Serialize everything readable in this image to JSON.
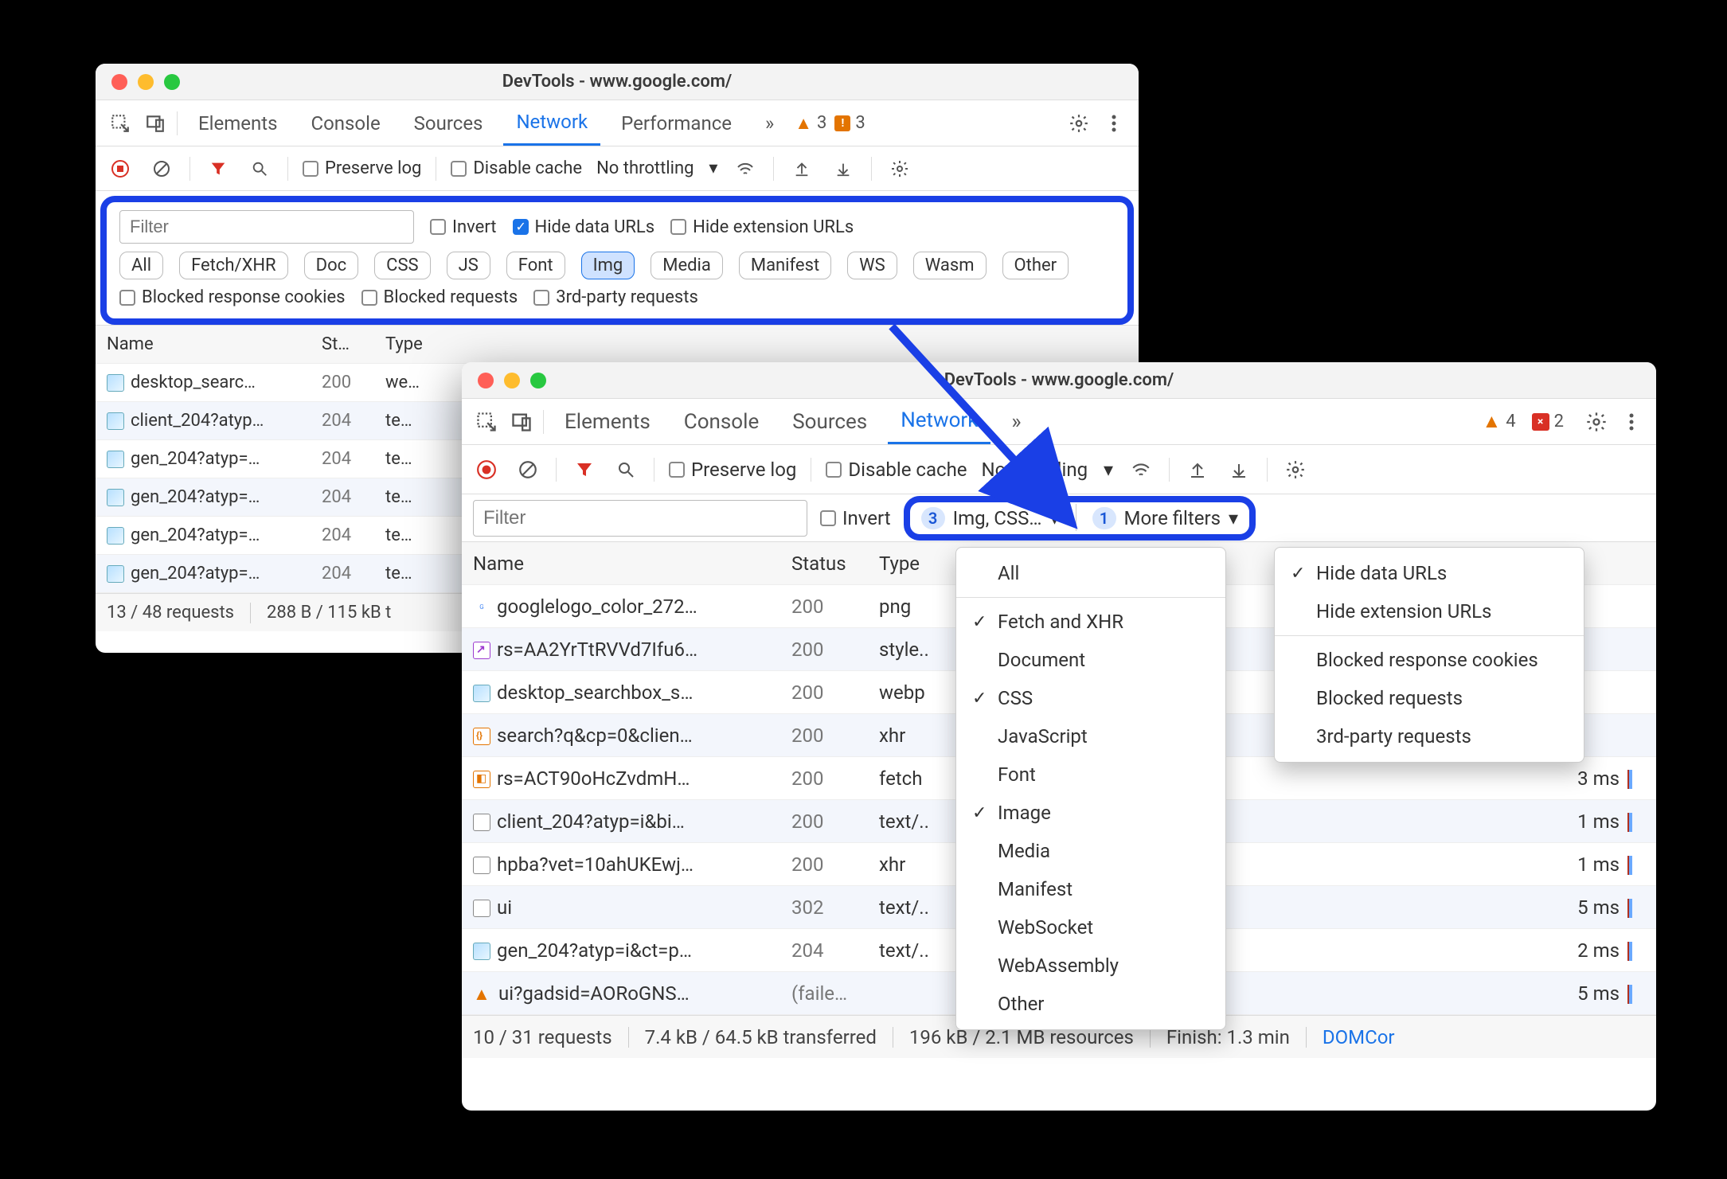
{
  "winA": {
    "title": "DevTools - www.google.com/",
    "tabs": [
      "Elements",
      "Console",
      "Sources",
      "Network",
      "Performance"
    ],
    "active_tab": "Network",
    "overflow": "»",
    "warn_count": "3",
    "err_count": "3",
    "toolbar": {
      "preserve_log": "Preserve log",
      "disable_cache": "Disable cache",
      "throttling": "No throttling"
    },
    "filter": {
      "placeholder": "Filter",
      "invert": "Invert",
      "hide_data": "Hide data URLs",
      "hide_ext": "Hide extension URLs",
      "types": [
        "All",
        "Fetch/XHR",
        "Doc",
        "CSS",
        "JS",
        "Font",
        "Img",
        "Media",
        "Manifest",
        "WS",
        "Wasm",
        "Other"
      ],
      "active_type": "Img",
      "blocked_cookies": "Blocked response cookies",
      "blocked_req": "Blocked requests",
      "third_party": "3rd-party requests"
    },
    "cols": {
      "name": "Name",
      "status": "St…",
      "type": "Type"
    },
    "rows": [
      {
        "name": "desktop_searc…",
        "status": "200",
        "type": "we…",
        "icon": "img"
      },
      {
        "name": "client_204?atyp…",
        "status": "204",
        "type": "te…",
        "icon": "img"
      },
      {
        "name": "gen_204?atyp=…",
        "status": "204",
        "type": "te…",
        "icon": "img"
      },
      {
        "name": "gen_204?atyp=…",
        "status": "204",
        "type": "te…",
        "icon": "img"
      },
      {
        "name": "gen_204?atyp=…",
        "status": "204",
        "type": "te…",
        "icon": "img"
      },
      {
        "name": "gen_204?atyp=…",
        "status": "204",
        "type": "te…",
        "icon": "img"
      }
    ],
    "status": {
      "req": "13 / 48 requests",
      "xfer": "288 B / 115 kB t"
    }
  },
  "winB": {
    "title": "DevTools - www.google.com/",
    "tabs": [
      "Elements",
      "Console",
      "Sources",
      "Network"
    ],
    "active_tab": "Network",
    "overflow": "»",
    "warn_count": "4",
    "err_count": "2",
    "toolbar": {
      "preserve_log": "Preserve log",
      "disable_cache": "Disable cache",
      "throttling": "No throttling"
    },
    "filter": {
      "placeholder": "Filter",
      "invert": "Invert",
      "types_summary_count": "3",
      "types_summary_label": "Img, CSS…",
      "more_count": "1",
      "more_label": "More filters"
    },
    "type_menu": [
      "All",
      "Fetch and XHR",
      "Document",
      "CSS",
      "JavaScript",
      "Font",
      "Image",
      "Media",
      "Manifest",
      "WebSocket",
      "WebAssembly",
      "Other"
    ],
    "type_menu_checked": [
      "Fetch and XHR",
      "CSS",
      "Image"
    ],
    "more_menu_top": [
      "Hide data URLs",
      "Hide extension URLs"
    ],
    "more_menu_top_checked": [
      "Hide data URLs"
    ],
    "more_menu_bottom": [
      "Blocked response cookies",
      "Blocked requests",
      "3rd-party requests"
    ],
    "cols": {
      "name": "Name",
      "status": "Status",
      "type": "Type"
    },
    "rows": [
      {
        "name": "googlelogo_color_272…",
        "status": "200",
        "type": "png",
        "icon": "logo",
        "time": ""
      },
      {
        "name": "rs=AA2YrTtRVVd7Ifu6…",
        "status": "200",
        "type": "style..",
        "icon": "style",
        "time": ""
      },
      {
        "name": "desktop_searchbox_s…",
        "status": "200",
        "type": "webp",
        "icon": "img",
        "time": ""
      },
      {
        "name": "search?q&cp=0&clien…",
        "status": "200",
        "type": "xhr",
        "icon": "js",
        "time": ""
      },
      {
        "name": "rs=ACT90oHcZvdmH…",
        "status": "200",
        "type": "fetch",
        "icon": "fetch",
        "time": "3 ms"
      },
      {
        "name": "client_204?atyp=i&bi…",
        "status": "200",
        "type": "text/..",
        "icon": "txt",
        "time": "1 ms"
      },
      {
        "name": "hpba?vet=10ahUKEwj…",
        "status": "200",
        "type": "xhr",
        "icon": "txt",
        "time": "1 ms"
      },
      {
        "name": "ui",
        "status": "302",
        "type": "text/..",
        "icon": "txt",
        "time": "5 ms"
      },
      {
        "name": "gen_204?atyp=i&ct=p…",
        "status": "204",
        "type": "text/..",
        "icon": "img",
        "time": "2 ms"
      },
      {
        "name": "ui?gadsid=AORoGNS…",
        "status": "(faile…",
        "type": "",
        "icon": "warn",
        "time": "5 ms"
      }
    ],
    "status": {
      "req": "10 / 31 requests",
      "xfer": "7.4 kB / 64.5 kB transferred",
      "res": "196 kB / 2.1 MB resources",
      "finish": "Finish: 1.3 min",
      "domcor": "DOMCor"
    }
  }
}
